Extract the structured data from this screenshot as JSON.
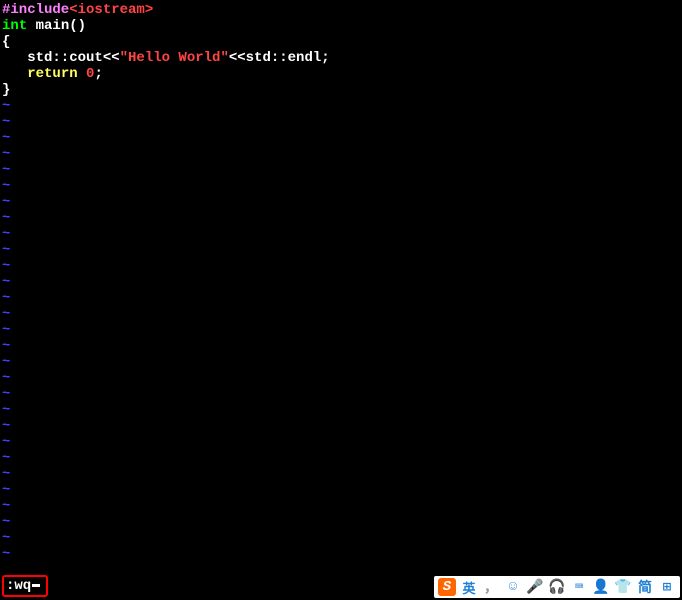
{
  "code": {
    "line1": {
      "include": "#include",
      "header": "<iostream>"
    },
    "line2": {
      "type": "int",
      "rest": " main()"
    },
    "line3": "{",
    "line4": {
      "indent": "   std::cout<<",
      "string": "\"Hello World\"",
      "after": "<<std::endl;"
    },
    "line5": {
      "indent": "   ",
      "return": "return",
      "space": " ",
      "value": "0",
      "semi": ";"
    },
    "line6": "}"
  },
  "tilde": "~",
  "command": ":wq",
  "ime": {
    "sogou": "S",
    "lang": "英",
    "punct": "，",
    "face": "☺",
    "mic": "🎤",
    "headphones": "🎧",
    "keyboard": "⌨",
    "person": "👤",
    "shirt": "👕",
    "simplified": "简",
    "grid": "⊞"
  }
}
